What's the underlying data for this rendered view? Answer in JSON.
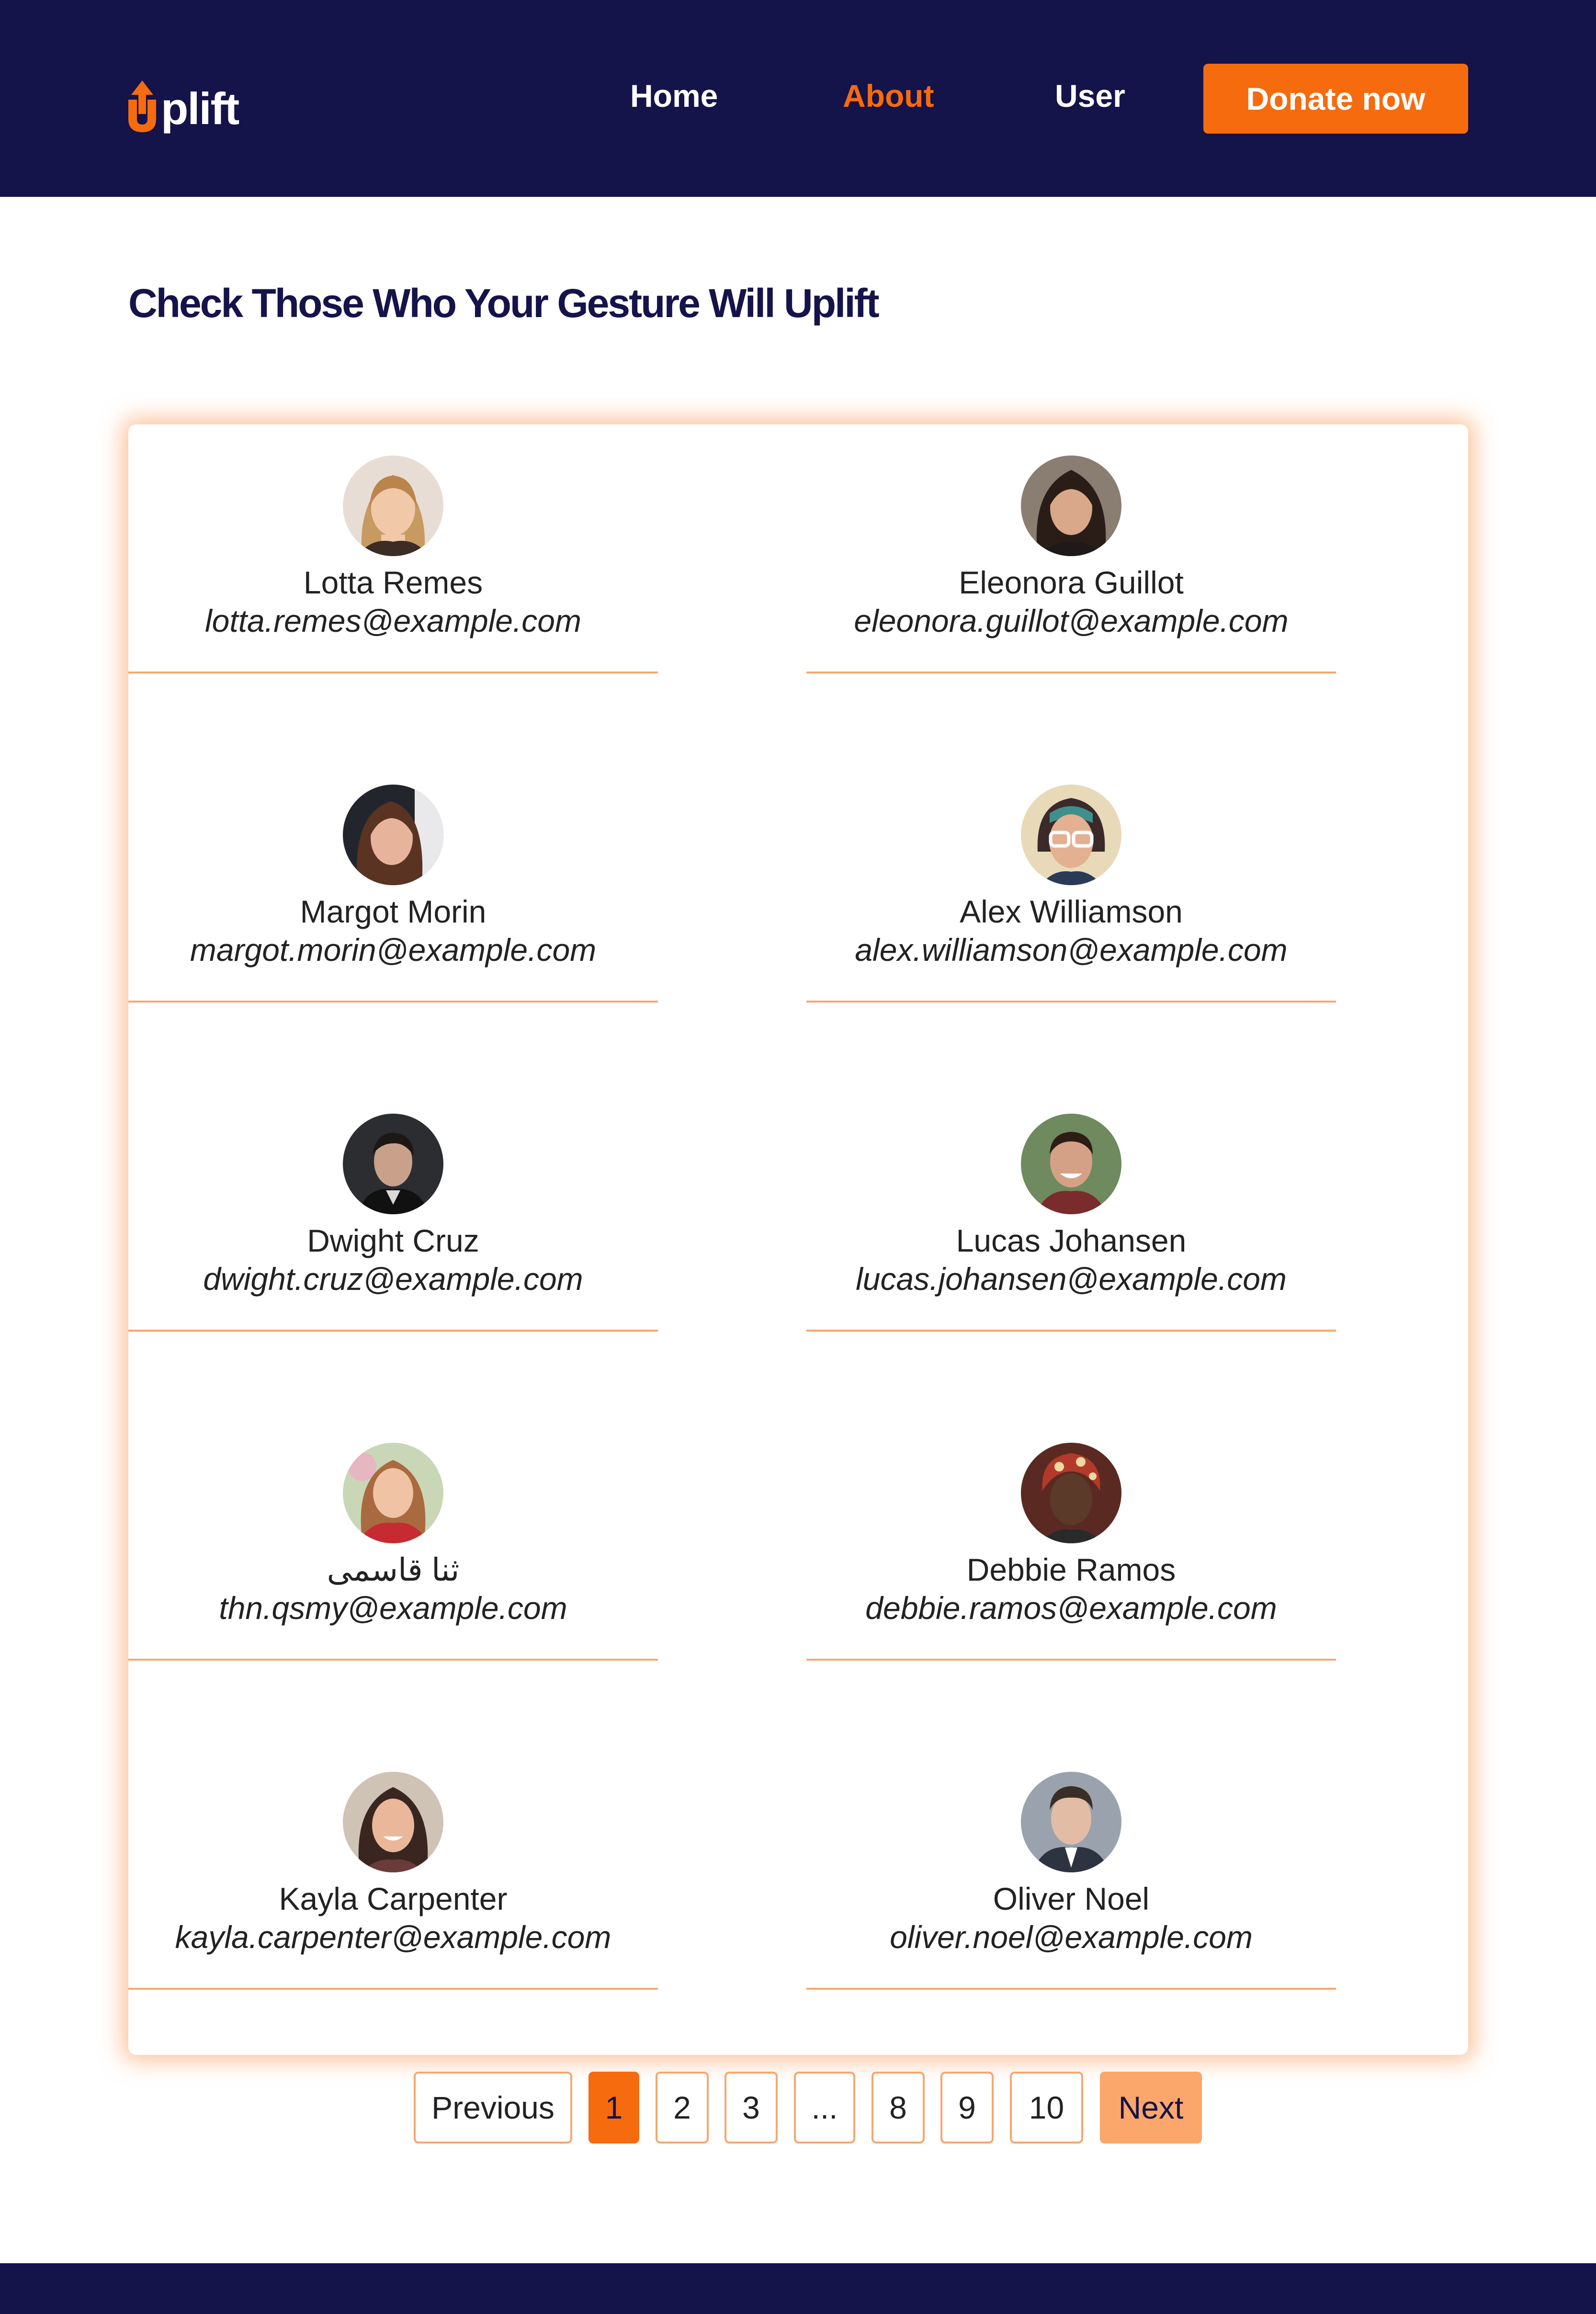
{
  "app": {
    "logo_text": "plift",
    "brand_colors": {
      "navy": "#14134a",
      "orange": "#f56b0e",
      "peach": "#fba66a"
    }
  },
  "nav": {
    "home_label": "Home",
    "about_label": "About",
    "user_label": "User",
    "active": "About",
    "donate_label": "Donate now"
  },
  "main": {
    "title": "Check Those Who Your Gesture Will Uplift"
  },
  "users": [
    {
      "name": "Lotta Remes",
      "email": "lotta.remes@example.com",
      "avatar": "avatar-woman-blonde"
    },
    {
      "name": "Eleonora Guillot",
      "email": "eleonora.guillot@example.com",
      "avatar": "avatar-woman-dark-hair"
    },
    {
      "name": "Margot Morin",
      "email": "margot.morin@example.com",
      "avatar": "avatar-woman-brown-hair"
    },
    {
      "name": "Alex Williamson",
      "email": "alex.williamson@example.com",
      "avatar": "avatar-woman-glasses"
    },
    {
      "name": "Dwight Cruz",
      "email": "dwight.cruz@example.com",
      "avatar": "avatar-man-dark"
    },
    {
      "name": "Lucas Johansen",
      "email": "lucas.johansen@example.com",
      "avatar": "avatar-man-smiling"
    },
    {
      "name": "ثنا قاسمی",
      "email": "thn.qsmy@example.com",
      "avatar": "avatar-woman-red-top"
    },
    {
      "name": "Debbie Ramos",
      "email": "debbie.ramos@example.com",
      "avatar": "avatar-woman-headwrap"
    },
    {
      "name": "Kayla Carpenter",
      "email": "kayla.carpenter@example.com",
      "avatar": "avatar-woman-smiling"
    },
    {
      "name": "Oliver Noel",
      "email": "oliver.noel@example.com",
      "avatar": "avatar-man-suit"
    }
  ],
  "pagination": {
    "previous_label": "Previous",
    "pages": [
      "1",
      "2",
      "3",
      "...",
      "8",
      "9",
      "10"
    ],
    "current_page": "1",
    "next_label": "Next"
  }
}
